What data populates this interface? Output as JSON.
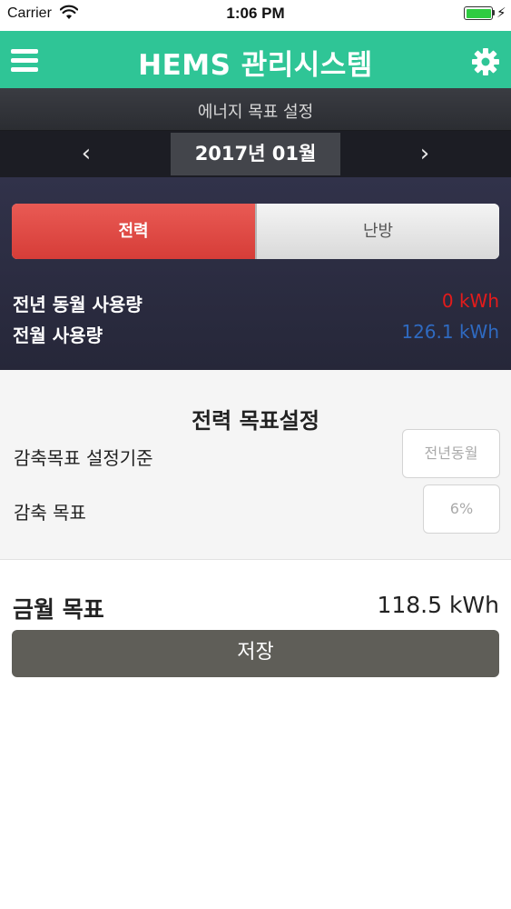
{
  "status_bar": {
    "carrier": "Carrier",
    "time": "1:06 PM",
    "battery_level": 1.0
  },
  "app_bar": {
    "title": "HEMS 관리시스템",
    "menu_icon": "hamburger-menu-icon",
    "settings_icon": "gear-icon",
    "color": "#2fc596"
  },
  "subtitle": "에너지 목표 설정",
  "month_selector": {
    "prev": "‹",
    "month": "2017년 01월",
    "next": "›"
  },
  "energy_tabs": {
    "active": "전력",
    "inactive": "난방",
    "active_color": "#e04a45"
  },
  "usage": {
    "last_year_label": "전년 동월 사용량",
    "last_year_value": "0 kWh",
    "last_year_color": "#e31b1b",
    "last_month_label": "전월 사용량",
    "last_month_value": "126.1 kWh",
    "last_month_color": "#2f6ac0"
  },
  "goal_setting": {
    "heading": "전력 목표설정",
    "basis_label": "감축목표 설정기준",
    "basis_value": "전년동월",
    "reduction_label": "감축 목표",
    "reduction_value": "6%"
  },
  "monthly_target": {
    "label": "금월 목표",
    "value": "118.5 kWh"
  },
  "save_button": "저장"
}
